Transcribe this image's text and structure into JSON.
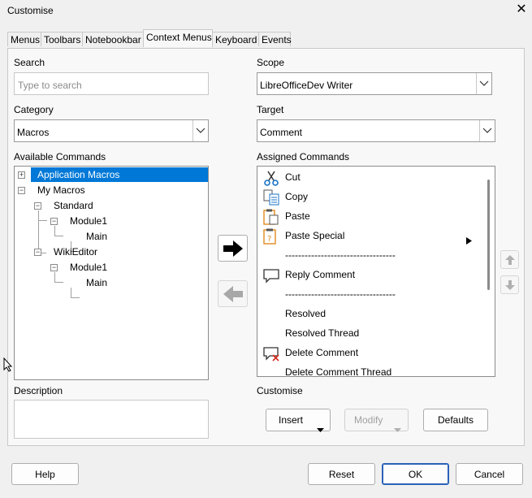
{
  "window": {
    "title": "Customise",
    "close_glyph": "✕"
  },
  "tabs": [
    {
      "label": "Menus"
    },
    {
      "label": "Toolbars"
    },
    {
      "label": "Notebookbar"
    },
    {
      "label": "Context Menus",
      "active": true
    },
    {
      "label": "Keyboard"
    },
    {
      "label": "Events"
    }
  ],
  "search": {
    "label": "Search",
    "placeholder": "Type to search"
  },
  "category": {
    "label": "Category",
    "value": "Macros"
  },
  "scope": {
    "label": "Scope",
    "value": "LibreOfficeDev Writer"
  },
  "target": {
    "label": "Target",
    "value": "Comment"
  },
  "available": {
    "label": "Available Commands",
    "tree": [
      {
        "label": "Application Macros",
        "level": 0,
        "expander": "+",
        "selected": true
      },
      {
        "label": "My Macros",
        "level": 0,
        "expander": "−"
      },
      {
        "label": "Standard",
        "level": 1,
        "expander": "−"
      },
      {
        "label": "Module1",
        "level": 2,
        "expander": "−"
      },
      {
        "label": "Main",
        "level": 3
      },
      {
        "label": "WikiEditor",
        "level": 1,
        "expander": "−"
      },
      {
        "label": "Module1",
        "level": 2,
        "expander": "−"
      },
      {
        "label": "Main",
        "level": 3
      }
    ]
  },
  "assigned": {
    "label": "Assigned Commands",
    "items": [
      {
        "label": "Cut",
        "icon": "scissors-icon"
      },
      {
        "label": "Copy",
        "icon": "copy-icon"
      },
      {
        "label": "Paste",
        "icon": "paste-icon"
      },
      {
        "label": "Paste Special",
        "icon": "paste-special-icon",
        "submenu": true
      },
      {
        "label": "----------------------------------",
        "separator": true
      },
      {
        "label": "Reply Comment",
        "icon": "reply-comment-icon"
      },
      {
        "label": "----------------------------------",
        "separator": true
      },
      {
        "label": "Resolved"
      },
      {
        "label": "Resolved Thread"
      },
      {
        "label": "Delete Comment",
        "icon": "delete-comment-icon"
      },
      {
        "label": "Delete Comment Thread"
      }
    ]
  },
  "description": {
    "label": "Description"
  },
  "customise": {
    "label": "Customise",
    "insert": "Insert",
    "modify": "Modify",
    "defaults": "Defaults"
  },
  "footer": {
    "help": "Help",
    "reset": "Reset",
    "ok": "OK",
    "cancel": "Cancel"
  },
  "colors": {
    "selection": "#0078d7",
    "accent_border": "#2b62b8"
  }
}
